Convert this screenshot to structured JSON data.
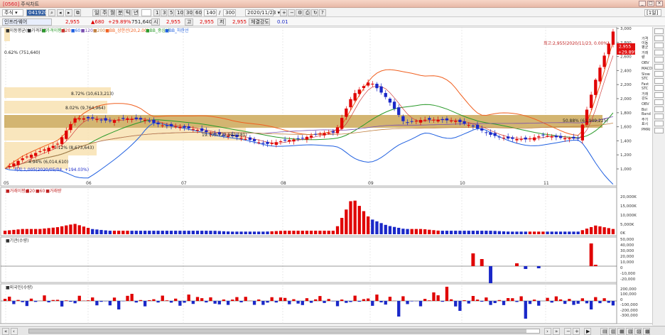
{
  "window": {
    "code": "[0560]",
    "title": "주식차트",
    "right_badge": "[1일]"
  },
  "toolbar": {
    "market": "주식",
    "stock_code": "041920",
    "period_buttons": [
      "주",
      "월",
      "분",
      "틱",
      "년"
    ],
    "minute_buttons": [
      "1",
      "3",
      "5",
      "10",
      "30",
      "60"
    ],
    "count_value": "140",
    "count_total": "300",
    "date_value": "2020/11/23"
  },
  "quote": {
    "name": "인프라웨어",
    "price": "2,955",
    "change": "▲680",
    "change_rate": "+29.89%",
    "volume": "751,640",
    "open_label": "시",
    "open": "2,955",
    "high_label": "고",
    "high": "2,955",
    "low_label": "저",
    "low": "2,955",
    "strength_label": "체결강도",
    "strength": "0.01"
  },
  "legend": {
    "main": [
      "■이동평균(9)",
      "■가격차트",
      "■가격이평 5",
      "■20",
      "■60",
      "■120",
      "■200",
      "■BB_상한선(20,2.00)",
      "■BB_중심선",
      "■BB_하한선"
    ],
    "volume": [
      "■거래이평 5",
      "■20",
      "■60",
      "■거래량"
    ],
    "inst": "■기관(수량)",
    "foreign": "■외국인(수량)"
  },
  "annotations": {
    "max_label": "최고:2,955(2020/11/23, 0.00%)",
    "min_label": "최저:1,005(2020/05/04, +194.03%)",
    "last_price_badge1": "2,955",
    "last_price_badge2": "+29.89%",
    "vp_labels": [
      {
        "text": "0.62% (751,640)"
      },
      {
        "text": "8.72% (10,613,213)"
      },
      {
        "text": "8.02% (9,764,964)"
      },
      {
        "text": "50.88% (61,949,225)"
      },
      {
        "text": "19.70% (23,992,181)"
      },
      {
        "text": "7.12% (8,673,643)"
      },
      {
        "text": "4.94% (6,014,610)"
      }
    ]
  },
  "axes": {
    "months": [
      "05",
      "06",
      "07",
      "08",
      "09",
      "10",
      "11"
    ],
    "price_ticks": [
      "3,000",
      "2,800",
      "2,600",
      "2,400",
      "2,200",
      "2,000",
      "1,800",
      "1,600",
      "1,400",
      "1,200",
      "1,000"
    ],
    "volume_ticks": [
      "20,000K",
      "15,000K",
      "10,000K",
      "5,000K",
      "0K"
    ],
    "inst_ticks": [
      "50,000",
      "40,000",
      "30,000",
      "20,000",
      "10,000",
      "0",
      "-10,000",
      "-20,000",
      "-30,000"
    ],
    "foreign_ticks": [
      "200,000",
      "100,000",
      "0",
      "-100,000",
      "-200,000",
      "-300,000"
    ]
  },
  "right_tools": [
    "가격 이동 평균",
    "거래 량",
    "OBV",
    "MACD",
    "Slow STC",
    "Fast STC",
    "거래 강도",
    "OBV",
    "Bol Band",
    "주가 표시",
    "PMRI"
  ],
  "colors": {
    "up": "#e00000",
    "down": "#1a28c8",
    "vp_light": "#f7e0ad",
    "vp_dark": "#c8a24e"
  }
}
